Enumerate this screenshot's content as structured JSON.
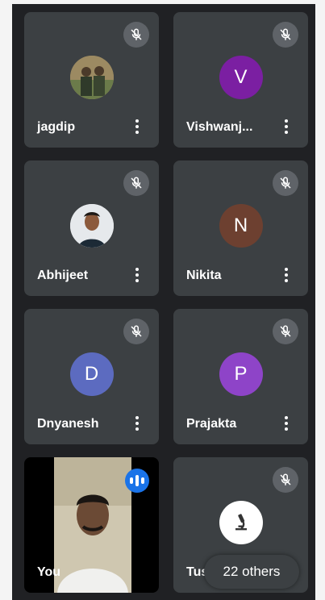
{
  "participants": [
    {
      "name": "jagdip",
      "initial": "",
      "avatar_type": "photo-two-people",
      "muted": true
    },
    {
      "name": "Vishwanj...",
      "initial": "V",
      "avatar_color": "#7b1fa2",
      "muted": true
    },
    {
      "name": "Abhijeet",
      "initial": "",
      "avatar_type": "photo-portrait",
      "muted": true
    },
    {
      "name": "Nikita",
      "initial": "N",
      "avatar_color": "#6d4030",
      "muted": true
    },
    {
      "name": "Dnyanesh",
      "initial": "D",
      "avatar_color": "#5c6bc0",
      "muted": true
    },
    {
      "name": "Prajakta",
      "initial": "P",
      "avatar_color": "#8e44c8",
      "muted": true
    },
    {
      "name": "You",
      "initial": "",
      "avatar_type": "live-video",
      "speaking": true
    },
    {
      "name": "Tushar",
      "initial": "",
      "avatar_type": "logo-icon",
      "muted": true
    }
  ],
  "others_label": "22 others",
  "colors": {
    "background": "#202124",
    "tile": "#3c4043",
    "speaking": "#1a73e8"
  }
}
